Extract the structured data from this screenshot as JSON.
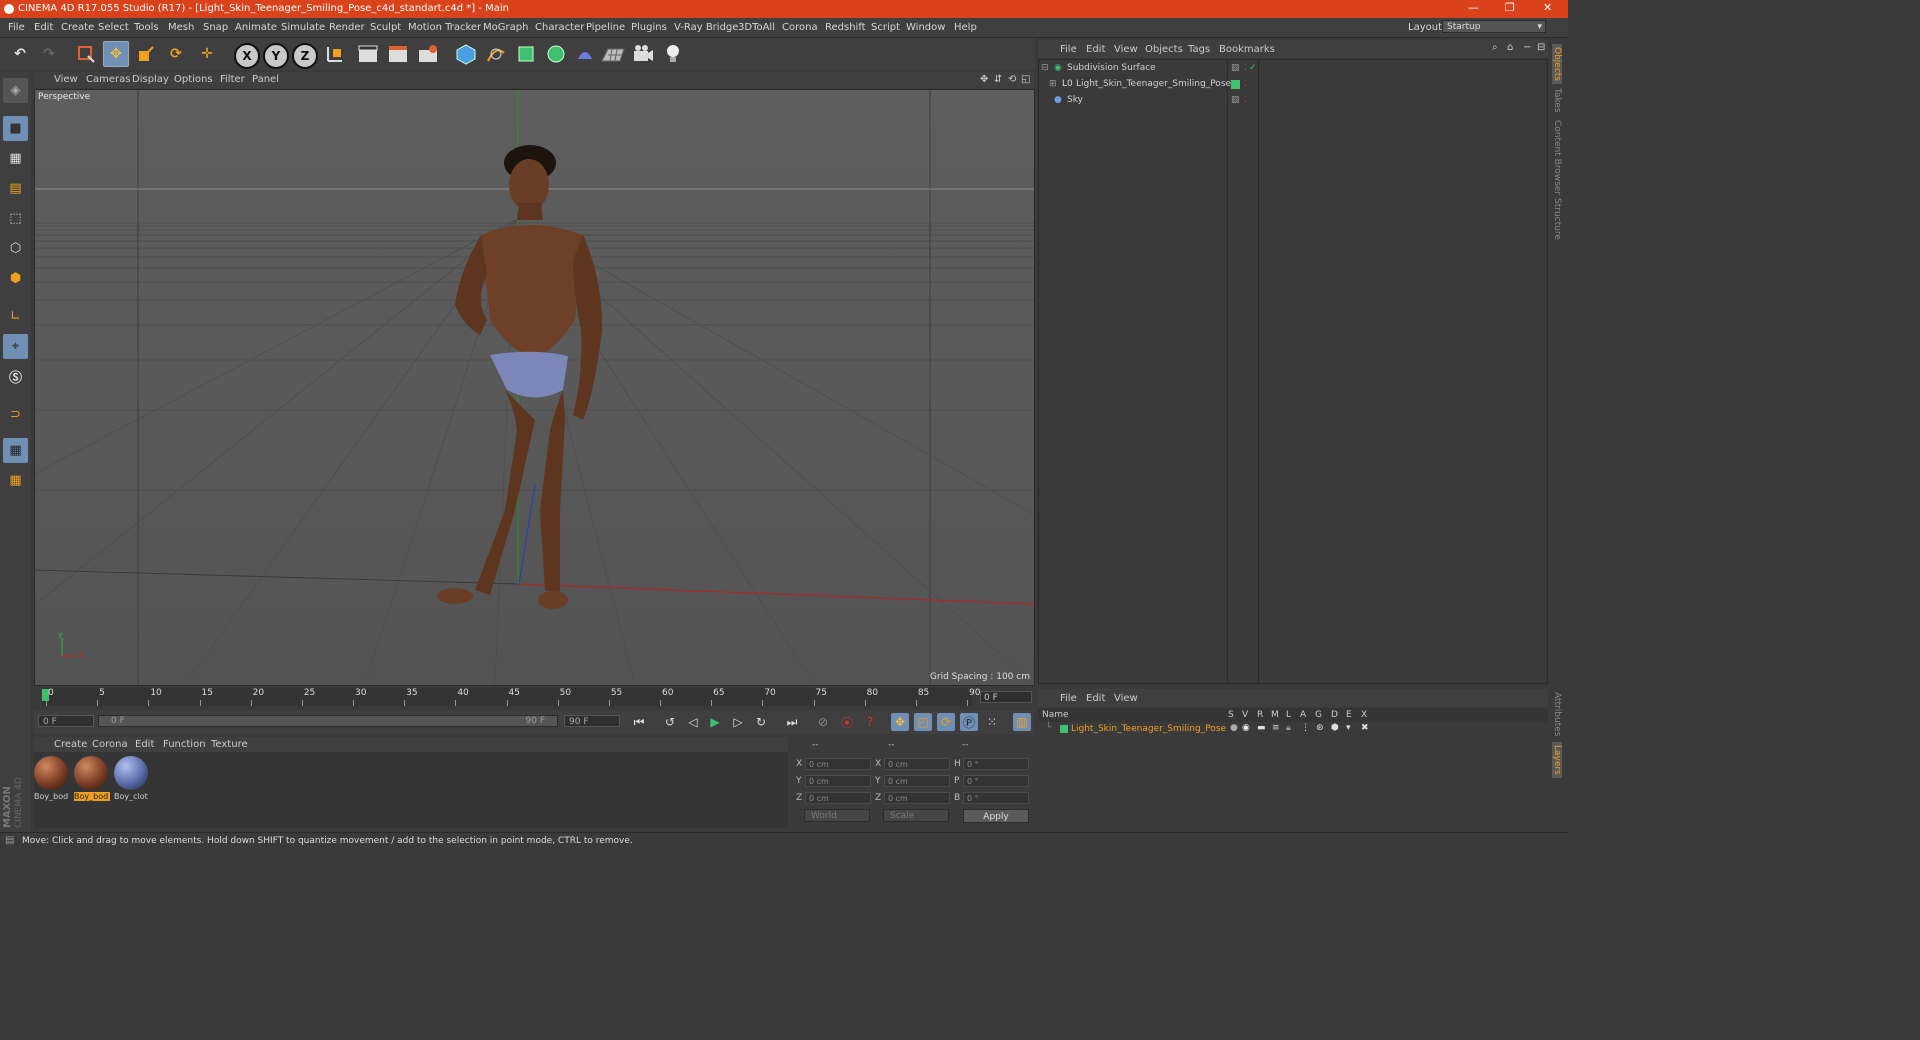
{
  "window": {
    "title": "CINEMA 4D R17.055 Studio (R17) - [Light_Skin_Teenager_Smiling_Pose_c4d_standart.c4d *] - Main",
    "minimize": "—",
    "restore": "❐",
    "close": "✕"
  },
  "menu": [
    "File",
    "Edit",
    "Create",
    "Select",
    "Tools",
    "Mesh",
    "Snap",
    "Animate",
    "Simulate",
    "Render",
    "Sculpt",
    "Motion Tracker",
    "MoGraph",
    "Character",
    "Pipeline",
    "Plugins",
    "V-Ray Bridge",
    "3DToAll",
    "Corona",
    "Redshift",
    "Script",
    "Window",
    "Help"
  ],
  "layout": {
    "label": "Layout:",
    "value": "Startup"
  },
  "toolbar": {
    "axis_x": "X",
    "axis_y": "Y",
    "axis_z": "Z"
  },
  "viewport": {
    "menu": [
      "View",
      "Cameras",
      "Display",
      "Options",
      "Filter",
      "Panel"
    ],
    "label": "Perspective",
    "grid_spacing": "Grid Spacing : 100 cm",
    "axis_y": "y",
    "axis_x": "x"
  },
  "timeline": {
    "ticks": [
      "0",
      "5",
      "10",
      "15",
      "20",
      "25",
      "30",
      "35",
      "40",
      "45",
      "50",
      "55",
      "60",
      "65",
      "70",
      "75",
      "80",
      "85",
      "90"
    ],
    "current_frame": "0 F"
  },
  "transport": {
    "start": "0 F",
    "range_start": "0 F",
    "range_end": "90 F",
    "end": "90 F"
  },
  "materials": {
    "menu": [
      "Create",
      "Corona",
      "Edit",
      "Function",
      "Texture"
    ],
    "items": [
      {
        "label": "Boy_bod",
        "color": "#7a3c24"
      },
      {
        "label": "Boy_bod",
        "color": "#7a3c24"
      },
      {
        "label": "Boy_clot",
        "color": "#5a6aa8"
      }
    ]
  },
  "coords": {
    "headers": [
      "--",
      "--",
      "--"
    ],
    "rows": [
      {
        "l1": "X",
        "v1": "0 cm",
        "l2": "X",
        "v2": "0 cm",
        "l3": "H",
        "v3": "0 °"
      },
      {
        "l1": "Y",
        "v1": "0 cm",
        "l2": "Y",
        "v2": "0 cm",
        "l3": "P",
        "v3": "0 °"
      },
      {
        "l1": "Z",
        "v1": "0 cm",
        "l2": "Z",
        "v2": "0 cm",
        "l3": "B",
        "v3": "0 °"
      }
    ],
    "mode1": "World",
    "mode2": "Scale",
    "apply": "Apply"
  },
  "objects": {
    "menu": [
      "File",
      "Edit",
      "View",
      "Objects",
      "Tags",
      "Bookmarks"
    ],
    "items": [
      "Subdivision Surface",
      "Light_Skin_Teenager_Smiling_Pose",
      "Sky"
    ]
  },
  "layers": {
    "menu": [
      "File",
      "Edit",
      "View"
    ],
    "columns": [
      "Name",
      "S",
      "V",
      "R",
      "M",
      "L",
      "A",
      "G",
      "D",
      "E",
      "X"
    ],
    "items": [
      "Light_Skin_Teenager_Smiling_Pose"
    ]
  },
  "right_tabs": [
    "Objects",
    "Takes",
    "Content Browser",
    "Structure",
    "Attributes",
    "Layers"
  ],
  "maxon": {
    "brand": "MAXON",
    "product": "CINEMA 4D"
  },
  "status": "Move: Click and drag to move elements. Hold down SHIFT to quantize movement / add to the selection in point mode, CTRL to remove."
}
